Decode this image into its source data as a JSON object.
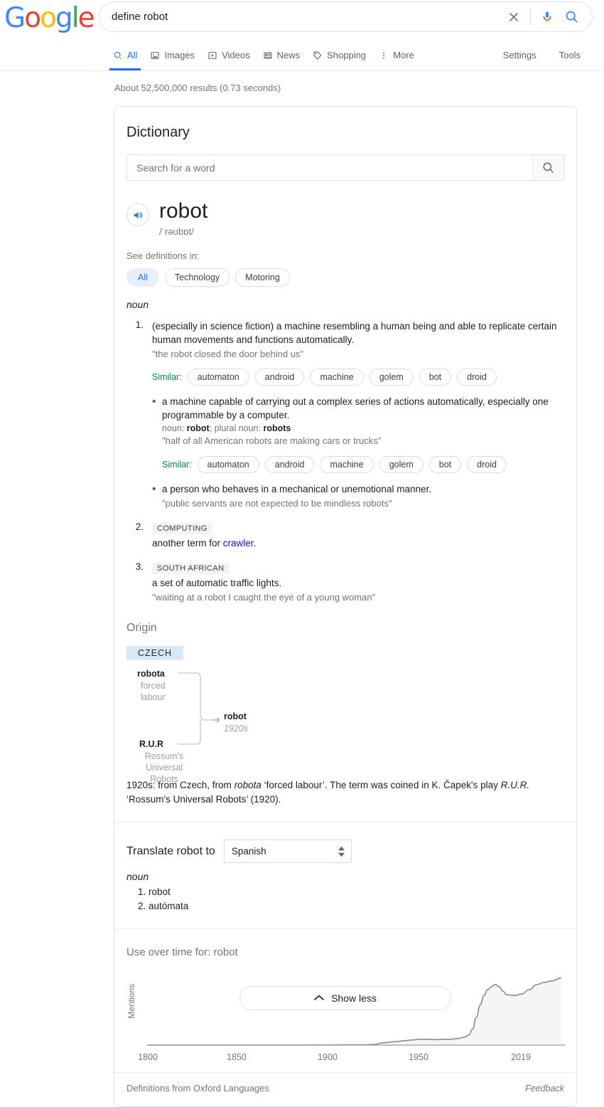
{
  "brand": {
    "logo_letters": [
      {
        "ch": "G",
        "color": "#4285F4"
      },
      {
        "ch": "o",
        "color": "#EA4335"
      },
      {
        "ch": "o",
        "color": "#FBBC05"
      },
      {
        "ch": "g",
        "color": "#4285F4"
      },
      {
        "ch": "l",
        "color": "#34A853"
      },
      {
        "ch": "e",
        "color": "#EA4335"
      }
    ]
  },
  "search": {
    "query": "define robot",
    "clear_icon": "close-icon",
    "voice_icon": "microphone-icon",
    "submit_icon": "search-icon"
  },
  "nav": {
    "tabs": [
      {
        "label": "All",
        "icon": "search-icon",
        "active": true
      },
      {
        "label": "Images",
        "icon": "image-icon",
        "active": false
      },
      {
        "label": "Videos",
        "icon": "video-icon",
        "active": false
      },
      {
        "label": "News",
        "icon": "news-icon",
        "active": false
      },
      {
        "label": "Shopping",
        "icon": "tag-icon",
        "active": false
      },
      {
        "label": "More",
        "icon": "more-vertical-icon",
        "active": false
      }
    ],
    "right": [
      {
        "label": "Settings"
      },
      {
        "label": "Tools"
      }
    ]
  },
  "results": {
    "stats": "About 52,500,000 results (0.73 seconds)"
  },
  "dictionary": {
    "title": "Dictionary",
    "word_search_placeholder": "Search for a word",
    "word_search_value": "",
    "search_button_icon": "search-icon",
    "headword": "robot",
    "phonetic": "/ˈrəʊbɒt/",
    "speaker_icon": "speaker-icon",
    "see_definitions_in_label": "See definitions in:",
    "domain_chips": [
      {
        "label": "All",
        "selected": true
      },
      {
        "label": "Technology",
        "selected": false
      },
      {
        "label": "Motoring",
        "selected": false
      }
    ],
    "part_of_speech": "noun",
    "senses": [
      {
        "number": "1.",
        "definition": "(especially in science fiction) a machine resembling a human being and able to replicate certain human movements and functions automatically.",
        "example": "\"the robot closed the door behind us\"",
        "similar_label": "Similar:",
        "similar": [
          "automaton",
          "android",
          "machine",
          "golem",
          "bot",
          "droid"
        ],
        "subsenses": [
          {
            "definition": "a machine capable of carrying out a complex series of actions automatically, especially one programmable by a computer.",
            "grammar_prefix": "noun: ",
            "grammar_word": "robot",
            "grammar_mid": "; plural noun: ",
            "grammar_plural": "robots",
            "example": "\"half of all American robots are making cars or trucks\"",
            "similar_label": "Similar:",
            "similar": [
              "automaton",
              "android",
              "machine",
              "golem",
              "bot",
              "droid"
            ]
          },
          {
            "definition": "a person who behaves in a mechanical or unemotional manner.",
            "example": "\"public servants are not expected to be mindless robots\""
          }
        ]
      },
      {
        "number": "2.",
        "badge": "COMPUTING",
        "definition_prefix": "another term for ",
        "definition_link": "crawler",
        "definition_suffix": "."
      },
      {
        "number": "3.",
        "badge": "SOUTH AFRICAN",
        "definition": "a set of automatic traffic lights.",
        "example": "\"waiting at a robot I caught the eye of a young woman\""
      }
    ],
    "origin": {
      "title": "Origin",
      "language_tag": "CZECH",
      "nodes": [
        {
          "strong": "robota",
          "weak": "forced\nlabour"
        },
        {
          "strong": "R.U.R",
          "weak": "Rossum's\nUniversal\nRobots"
        }
      ],
      "result_word": "robot",
      "result_date": "1920s",
      "paragraph_parts": [
        {
          "text": "1920s: from Czech, from ",
          "italic": false
        },
        {
          "text": "robota",
          "italic": true
        },
        {
          "text": " ‘forced labour’. The term was coined in K. Čapek's play ",
          "italic": false
        },
        {
          "text": "R.U.R.",
          "italic": true
        },
        {
          "text": " ‘Rossum's Universal Robots’ (1920).",
          "italic": false
        }
      ]
    },
    "translate": {
      "label": "Translate robot to",
      "selected_language": "Spanish",
      "part_of_speech": "noun",
      "translations": [
        "robot",
        "autómata"
      ]
    },
    "footer": {
      "source": "Definitions from Oxford Languages",
      "feedback": "Feedback"
    }
  },
  "show_less": {
    "label": "Show less",
    "icon": "chevron-up-icon"
  },
  "chart_data": {
    "type": "area",
    "title": "Use over time for: robot",
    "xlabel": "",
    "ylabel": "Mentions",
    "xlim": [
      1800,
      2019
    ],
    "ylim": [
      0,
      100
    ],
    "grid": false,
    "legend": "none",
    "tick_labels": [
      "1800",
      "1850",
      "1900",
      "1950",
      "2019"
    ],
    "ticks": [
      1800,
      1850,
      1900,
      1950,
      2019
    ],
    "line_color": "#8a8a8a",
    "fill_color": "#f5f5f5",
    "x": [
      1800,
      1850,
      1880,
      1900,
      1915,
      1920,
      1924,
      1928,
      1932,
      1936,
      1940,
      1944,
      1948,
      1952,
      1956,
      1960,
      1964,
      1968,
      1970,
      1972,
      1974,
      1976,
      1978,
      1980,
      1982,
      1984,
      1986,
      1988,
      1990,
      1994,
      1998,
      2002,
      2006,
      2010,
      2014,
      2019
    ],
    "values": [
      0,
      0,
      0,
      0.3,
      0.5,
      1,
      3,
      4,
      5,
      6,
      7,
      8,
      8,
      7.5,
      8,
      8,
      9,
      11,
      14,
      22,
      38,
      55,
      68,
      76,
      80,
      83,
      80,
      74,
      69,
      68,
      70,
      76,
      83,
      86,
      88,
      92
    ]
  }
}
